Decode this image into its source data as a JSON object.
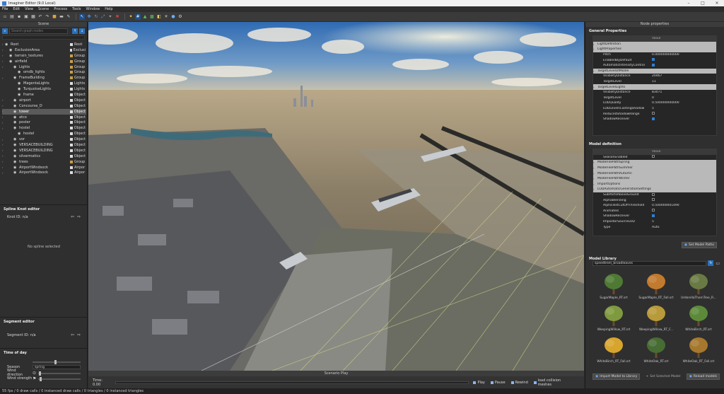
{
  "window": {
    "title": "Imaginer Editor (9.0 Local)"
  },
  "menu": [
    "File",
    "Edit",
    "View",
    "Scene",
    "Process",
    "Tools",
    "Window",
    "Help"
  ],
  "scene_panel": {
    "title": "Scene",
    "search_placeholder": "Search graph nodes"
  },
  "tree": [
    {
      "indent": 0,
      "name": "Root",
      "type": "Root",
      "icon": "o"
    },
    {
      "indent": 1,
      "name": "ExclusionArea",
      "type": "Exclusi",
      "icon": "o"
    },
    {
      "indent": 1,
      "name": "terrain_textures",
      "type": "Group",
      "icon": "g"
    },
    {
      "indent": 1,
      "name": "airfield",
      "type": "Group",
      "icon": "g"
    },
    {
      "indent": 2,
      "name": "Lights",
      "type": "Group",
      "icon": "g"
    },
    {
      "indent": 3,
      "name": "omdb_lights",
      "type": "Group",
      "icon": "g"
    },
    {
      "indent": 2,
      "name": "FrameBuilding",
      "type": "Group",
      "icon": "g"
    },
    {
      "indent": 3,
      "name": "MagentaLights",
      "type": "Lights",
      "icon": "o"
    },
    {
      "indent": 3,
      "name": "TurquoiseLights",
      "type": "Lights",
      "icon": "o"
    },
    {
      "indent": 3,
      "name": "frame",
      "type": "Object",
      "icon": "o"
    },
    {
      "indent": 2,
      "name": "airport",
      "type": "Object",
      "icon": "o"
    },
    {
      "indent": 2,
      "name": "Concourse_D",
      "type": "Object",
      "icon": "o"
    },
    {
      "indent": 2,
      "name": "tower",
      "type": "Object",
      "icon": "o",
      "selected": true
    },
    {
      "indent": 2,
      "name": "atco",
      "type": "Object",
      "icon": "o"
    },
    {
      "indent": 2,
      "name": "poster",
      "type": "Object",
      "icon": "o"
    },
    {
      "indent": 2,
      "name": "hostel",
      "type": "Object",
      "icon": "o"
    },
    {
      "indent": 3,
      "name": "hostel",
      "type": "Object",
      "icon": "o"
    },
    {
      "indent": 2,
      "name": "vor",
      "type": "Object",
      "icon": "o"
    },
    {
      "indent": 2,
      "name": "VERSACEBUILDING",
      "type": "Object",
      "icon": "o"
    },
    {
      "indent": 2,
      "name": "VERSACEBUILDING",
      "type": "Object",
      "icon": "o"
    },
    {
      "indent": 2,
      "name": "silvermatics",
      "type": "Object",
      "icon": "o"
    },
    {
      "indent": 2,
      "name": "trees",
      "type": "Group",
      "icon": "g"
    },
    {
      "indent": 2,
      "name": "AirportWindsock",
      "type": "Airpor",
      "icon": "o"
    },
    {
      "indent": 2,
      "name": "AirportWindsock",
      "type": "Airpor",
      "icon": "o"
    }
  ],
  "spline": {
    "title": "Spline Knot editor",
    "knot_id": "Knot ID: n/a",
    "empty": "No spline selected"
  },
  "segment": {
    "title": "Segment editor",
    "seg_id": "Segment ID: n/a"
  },
  "time_of_day": {
    "title": "Time of day",
    "season_label": "Season",
    "season_value": "spring",
    "wind_dir_label": "Wind direction",
    "wind_str_label": "Wind strength"
  },
  "status": "55 fps / 0 draw calls / 0 instanced draw calls / 0 triangles / 0 instanced triangles",
  "timeline": {
    "title": "Scenario Play",
    "time": "Time: 0.00",
    "play": "Play",
    "pause": "Pause",
    "rewind": "Rewind",
    "load": "load collision meshes"
  },
  "node_props": {
    "title": "Node properties"
  },
  "general": {
    "title": "General Properties",
    "header_value": "Value",
    "rows": [
      {
        "kind": "grp",
        "name": "LightDefinition",
        "value": ""
      },
      {
        "kind": "grp",
        "name": "LightProperties",
        "value": ""
      },
      {
        "kind": "row",
        "name": "Pitch",
        "value": "0.000000000000"
      },
      {
        "kind": "row",
        "name": "EnabledByDefault",
        "value": "",
        "check": true
      },
      {
        "kind": "row",
        "name": "AutomaticIntensityControl",
        "value": "",
        "check": true
      },
      {
        "kind": "grp",
        "name": "TargetLevelOfModel",
        "value": ""
      },
      {
        "kind": "row",
        "name": "VisibilityDistance",
        "value": "20467"
      },
      {
        "kind": "row",
        "name": "TargetLevel",
        "value": "11"
      },
      {
        "kind": "grp",
        "name": "TargetLevelLights",
        "value": ""
      },
      {
        "kind": "row",
        "name": "VisibilityDistance",
        "value": "83071"
      },
      {
        "kind": "row",
        "name": "TargetLevel",
        "value": "0"
      },
      {
        "kind": "row",
        "name": "LODQuality",
        "value": "0.500000000000"
      },
      {
        "kind": "row",
        "name": "LODLevelsCastingShadow",
        "value": "5"
      },
      {
        "kind": "row",
        "name": "ReducedShadowRange",
        "value": "",
        "check": false
      },
      {
        "kind": "row",
        "name": "ShadowReceiver",
        "value": "",
        "check": true
      }
    ]
  },
  "model_def": {
    "title": "Model definition",
    "header_value": "Value",
    "rows": [
      {
        "kind": "row",
        "name": "SeasonEnabled",
        "value": "",
        "check": false
      },
      {
        "kind": "grp",
        "name": "ModelFilePathSpring",
        "value": ""
      },
      {
        "kind": "grp",
        "name": "ModelFilePathSummer",
        "value": ""
      },
      {
        "kind": "grp",
        "name": "ModelFilePathAutumn",
        "value": ""
      },
      {
        "kind": "grp",
        "name": "ModelFilePathWinter",
        "value": ""
      },
      {
        "kind": "grp",
        "name": "ImportOptions",
        "value": ""
      },
      {
        "kind": "grp",
        "name": "LODAutomaticGenerationSettings",
        "value": ""
      },
      {
        "kind": "row",
        "name": "SubPartsAboveGround",
        "value": "",
        "check": false
      },
      {
        "kind": "row",
        "name": "AlphaBlending",
        "value": "",
        "check": false
      },
      {
        "kind": "row",
        "name": "AlphaTestCutOffThreshold",
        "value": "0.500000001490"
      },
      {
        "kind": "row",
        "name": "Animated",
        "value": "",
        "check": false
      },
      {
        "kind": "row",
        "name": "ShadowReceiver",
        "value": "",
        "check": true
      },
      {
        "kind": "row",
        "name": "ImpostorSourceLOD",
        "value": "5"
      },
      {
        "kind": "row",
        "name": "Type",
        "value": "Auto"
      }
    ],
    "set_paths": "Set Model Paths"
  },
  "library": {
    "title": "Model Library",
    "path": "speedtree\\_broadleaves",
    "items": [
      {
        "name": "SugarMaple_RT.srt",
        "color": "#4f7a34"
      },
      {
        "name": "SugarMaple_RT_Fall.srt",
        "color": "#c27a2e"
      },
      {
        "name": "UmbrellaThornTree_R...",
        "color": "#6a7a44"
      },
      {
        "name": "WeepingWillow_RT.srt",
        "color": "#7f9a3e"
      },
      {
        "name": "WeepingWillow_RT_F...",
        "color": "#b89a3a"
      },
      {
        "name": "WhiteBirch_RT.srt",
        "color": "#5d8a3a"
      },
      {
        "name": "WhiteBirch_RT_Fall.srt",
        "color": "#d7a52e"
      },
      {
        "name": "WhiteOak_RT.srt",
        "color": "#476c34"
      },
      {
        "name": "WhiteOak_RT_Fall.srt",
        "color": "#a6782e"
      }
    ],
    "import": "Import Model to Library",
    "set_selected": "Set Selected Model",
    "reload": "Reload models"
  }
}
